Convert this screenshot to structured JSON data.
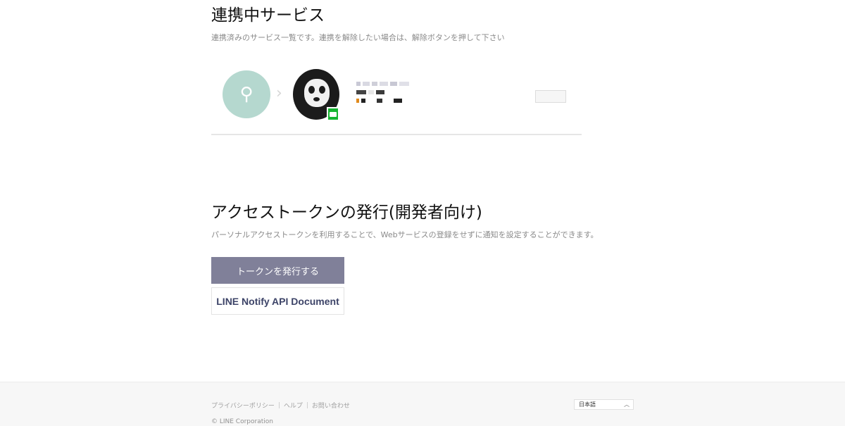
{
  "connected_services": {
    "title": "連携中サービス",
    "description": "連携済みのサービス一覧です。連携を解除したい場合は、解除ボタンを押して下さい",
    "service": {
      "icon": "service-icon",
      "badge_color": "#16b531"
    }
  },
  "access_token": {
    "title": "アクセストークンの発行(開発者向け)",
    "description": "パーソナルアクセストークンを利用することで、Webサービスの登録をせずに通知を設定することができます。",
    "issue_button": "トークンを発行する",
    "docs_button": "LINE Notify API Document"
  },
  "footer": {
    "links": [
      "プライバシーポリシー",
      "ヘルプ",
      "お問い合わせ"
    ],
    "language": "日本語",
    "copyright": "© LINE Corporation"
  },
  "colors": {
    "primary_button": "#808099",
    "doc_button_text": "#3d4468",
    "service_icon_bg": "#b5d8cf"
  }
}
